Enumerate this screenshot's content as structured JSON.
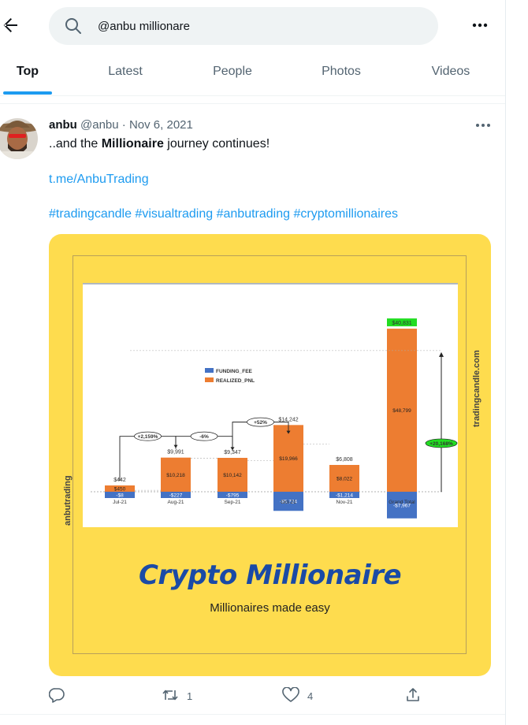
{
  "search": {
    "query": "@anbu millionare"
  },
  "tabs": [
    {
      "label": "Top",
      "active": true
    },
    {
      "label": "Latest"
    },
    {
      "label": "People"
    },
    {
      "label": "Photos"
    },
    {
      "label": "Videos"
    }
  ],
  "tweet": {
    "name": "anbu",
    "handle": "@anbu",
    "sep": "·",
    "date": "Nov 6, 2021",
    "text_pre": "..and the ",
    "text_bold": "Millionaire",
    "text_post": " journey continues!",
    "link": "t.me/AnbuTrading",
    "hashtags": [
      "#tradingcandle",
      "#visualtrading",
      "#anbutrading",
      "#cryptomillionaires"
    ],
    "retweets": "1",
    "likes": "4"
  },
  "media": {
    "side_left": "anbutrading",
    "side_right": "tradingcandle.com",
    "brand": "Crypto Millionaire",
    "tagline": "Millionaires made easy",
    "legend": [
      "FUNDING_FEE",
      "REALIZED_PNL"
    ],
    "colors": {
      "funding": "#4472c4",
      "realized": "#ed7d31",
      "green": "#22dd22",
      "accent": "#1d9bf0"
    }
  },
  "chart_data": {
    "type": "bar",
    "categories": [
      "Jul-21",
      "Aug-21",
      "Sep-21",
      "Oct-21",
      "Nov-21",
      "Grand Total"
    ],
    "series": [
      {
        "name": "FUNDING_FEE",
        "values": [
          -8,
          -227,
          -795,
          -5724,
          -1214,
          -7967
        ]
      },
      {
        "name": "REALIZED_PNL",
        "values": [
          450,
          10218,
          10142,
          19966,
          8022,
          48799
        ]
      }
    ],
    "totals": [
      442,
      9991,
      9347,
      14242,
      6808,
      40831
    ],
    "funding_labels": [
      "-$8",
      "-$227",
      "-$795",
      "-$5,724",
      "-$1,214",
      "-$7,967"
    ],
    "realized_labels": [
      "$450",
      "$10,218",
      "$10,142",
      "$19,966",
      "$8,022",
      "$48,799"
    ],
    "total_labels": [
      "$442",
      "$9,991",
      "$9,347",
      "$14,242",
      "$6,808",
      "$40,831"
    ],
    "growth_labels": [
      "+2,159%",
      "-6%",
      "+52%"
    ],
    "total_growth_label": "+20,168%"
  }
}
